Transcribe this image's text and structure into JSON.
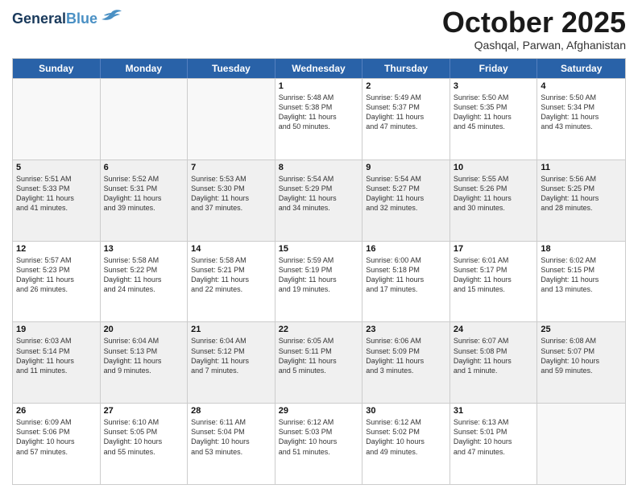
{
  "header": {
    "logo_line1": "General",
    "logo_line2": "Blue",
    "month": "October 2025",
    "location": "Qashqal, Parwan, Afghanistan"
  },
  "weekdays": [
    "Sunday",
    "Monday",
    "Tuesday",
    "Wednesday",
    "Thursday",
    "Friday",
    "Saturday"
  ],
  "rows": [
    {
      "shaded": false,
      "cells": [
        {
          "day": "",
          "info": ""
        },
        {
          "day": "",
          "info": ""
        },
        {
          "day": "",
          "info": ""
        },
        {
          "day": "1",
          "info": "Sunrise: 5:48 AM\nSunset: 5:38 PM\nDaylight: 11 hours\nand 50 minutes."
        },
        {
          "day": "2",
          "info": "Sunrise: 5:49 AM\nSunset: 5:37 PM\nDaylight: 11 hours\nand 47 minutes."
        },
        {
          "day": "3",
          "info": "Sunrise: 5:50 AM\nSunset: 5:35 PM\nDaylight: 11 hours\nand 45 minutes."
        },
        {
          "day": "4",
          "info": "Sunrise: 5:50 AM\nSunset: 5:34 PM\nDaylight: 11 hours\nand 43 minutes."
        }
      ]
    },
    {
      "shaded": true,
      "cells": [
        {
          "day": "5",
          "info": "Sunrise: 5:51 AM\nSunset: 5:33 PM\nDaylight: 11 hours\nand 41 minutes."
        },
        {
          "day": "6",
          "info": "Sunrise: 5:52 AM\nSunset: 5:31 PM\nDaylight: 11 hours\nand 39 minutes."
        },
        {
          "day": "7",
          "info": "Sunrise: 5:53 AM\nSunset: 5:30 PM\nDaylight: 11 hours\nand 37 minutes."
        },
        {
          "day": "8",
          "info": "Sunrise: 5:54 AM\nSunset: 5:29 PM\nDaylight: 11 hours\nand 34 minutes."
        },
        {
          "day": "9",
          "info": "Sunrise: 5:54 AM\nSunset: 5:27 PM\nDaylight: 11 hours\nand 32 minutes."
        },
        {
          "day": "10",
          "info": "Sunrise: 5:55 AM\nSunset: 5:26 PM\nDaylight: 11 hours\nand 30 minutes."
        },
        {
          "day": "11",
          "info": "Sunrise: 5:56 AM\nSunset: 5:25 PM\nDaylight: 11 hours\nand 28 minutes."
        }
      ]
    },
    {
      "shaded": false,
      "cells": [
        {
          "day": "12",
          "info": "Sunrise: 5:57 AM\nSunset: 5:23 PM\nDaylight: 11 hours\nand 26 minutes."
        },
        {
          "day": "13",
          "info": "Sunrise: 5:58 AM\nSunset: 5:22 PM\nDaylight: 11 hours\nand 24 minutes."
        },
        {
          "day": "14",
          "info": "Sunrise: 5:58 AM\nSunset: 5:21 PM\nDaylight: 11 hours\nand 22 minutes."
        },
        {
          "day": "15",
          "info": "Sunrise: 5:59 AM\nSunset: 5:19 PM\nDaylight: 11 hours\nand 19 minutes."
        },
        {
          "day": "16",
          "info": "Sunrise: 6:00 AM\nSunset: 5:18 PM\nDaylight: 11 hours\nand 17 minutes."
        },
        {
          "day": "17",
          "info": "Sunrise: 6:01 AM\nSunset: 5:17 PM\nDaylight: 11 hours\nand 15 minutes."
        },
        {
          "day": "18",
          "info": "Sunrise: 6:02 AM\nSunset: 5:15 PM\nDaylight: 11 hours\nand 13 minutes."
        }
      ]
    },
    {
      "shaded": true,
      "cells": [
        {
          "day": "19",
          "info": "Sunrise: 6:03 AM\nSunset: 5:14 PM\nDaylight: 11 hours\nand 11 minutes."
        },
        {
          "day": "20",
          "info": "Sunrise: 6:04 AM\nSunset: 5:13 PM\nDaylight: 11 hours\nand 9 minutes."
        },
        {
          "day": "21",
          "info": "Sunrise: 6:04 AM\nSunset: 5:12 PM\nDaylight: 11 hours\nand 7 minutes."
        },
        {
          "day": "22",
          "info": "Sunrise: 6:05 AM\nSunset: 5:11 PM\nDaylight: 11 hours\nand 5 minutes."
        },
        {
          "day": "23",
          "info": "Sunrise: 6:06 AM\nSunset: 5:09 PM\nDaylight: 11 hours\nand 3 minutes."
        },
        {
          "day": "24",
          "info": "Sunrise: 6:07 AM\nSunset: 5:08 PM\nDaylight: 11 hours\nand 1 minute."
        },
        {
          "day": "25",
          "info": "Sunrise: 6:08 AM\nSunset: 5:07 PM\nDaylight: 10 hours\nand 59 minutes."
        }
      ]
    },
    {
      "shaded": false,
      "cells": [
        {
          "day": "26",
          "info": "Sunrise: 6:09 AM\nSunset: 5:06 PM\nDaylight: 10 hours\nand 57 minutes."
        },
        {
          "day": "27",
          "info": "Sunrise: 6:10 AM\nSunset: 5:05 PM\nDaylight: 10 hours\nand 55 minutes."
        },
        {
          "day": "28",
          "info": "Sunrise: 6:11 AM\nSunset: 5:04 PM\nDaylight: 10 hours\nand 53 minutes."
        },
        {
          "day": "29",
          "info": "Sunrise: 6:12 AM\nSunset: 5:03 PM\nDaylight: 10 hours\nand 51 minutes."
        },
        {
          "day": "30",
          "info": "Sunrise: 6:12 AM\nSunset: 5:02 PM\nDaylight: 10 hours\nand 49 minutes."
        },
        {
          "day": "31",
          "info": "Sunrise: 6:13 AM\nSunset: 5:01 PM\nDaylight: 10 hours\nand 47 minutes."
        },
        {
          "day": "",
          "info": ""
        }
      ]
    }
  ]
}
